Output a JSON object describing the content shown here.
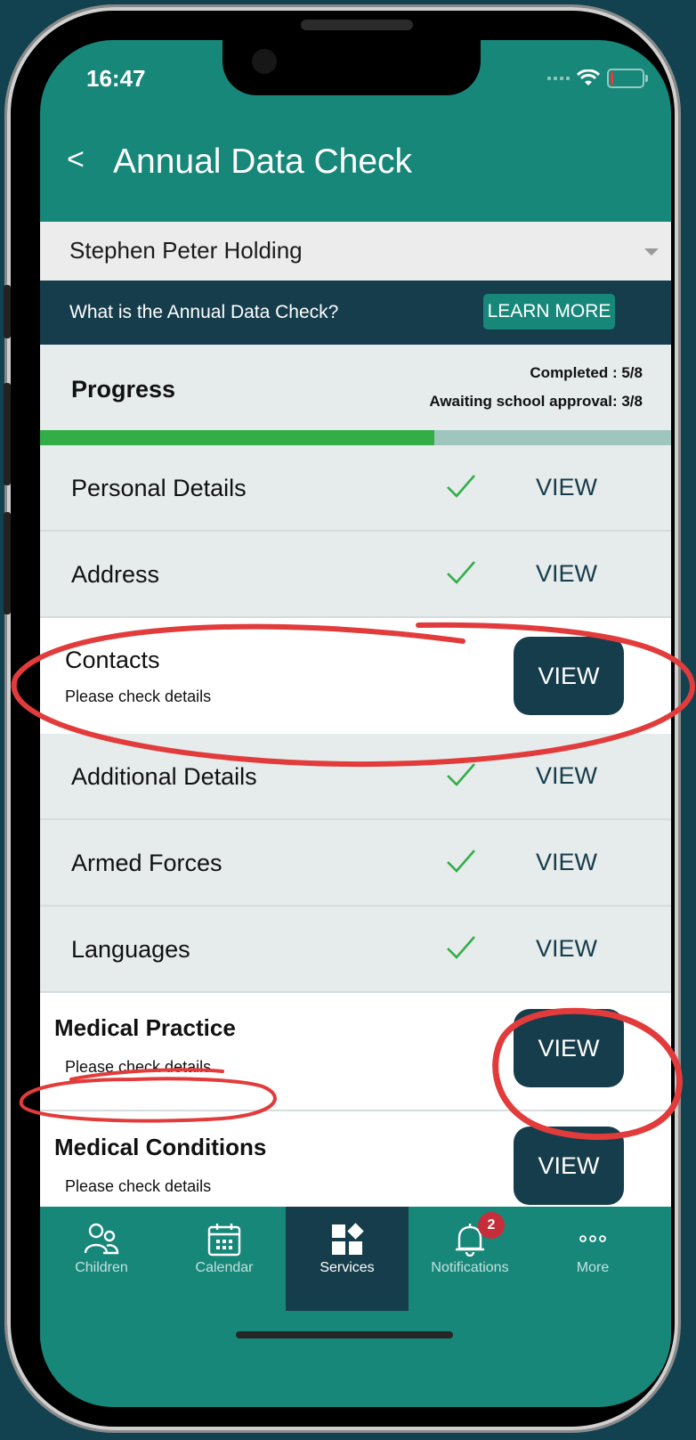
{
  "status_bar": {
    "time": "16:47"
  },
  "header": {
    "back_label": "<",
    "title": "Annual Data Check"
  },
  "child_picker": {
    "selected": "Stephen Peter Holding"
  },
  "info_banner": {
    "text": "What is the Annual Data Check?",
    "button_label": "LEARN MORE"
  },
  "progress": {
    "label": "Progress",
    "completed_text": "Completed : 5/8",
    "awaiting_text": "Awaiting school approval: 3/8",
    "completed_fraction": 0.625
  },
  "sections": [
    {
      "title": "Personal Details",
      "status": "done",
      "view_label": "VIEW"
    },
    {
      "title": "Address",
      "status": "done",
      "view_label": "VIEW"
    },
    {
      "title": "Contacts",
      "status": "todo",
      "subtitle": "Please check details",
      "view_label": "VIEW"
    },
    {
      "title": "Additional Details",
      "status": "done",
      "view_label": "VIEW"
    },
    {
      "title": "Armed Forces",
      "status": "done",
      "view_label": "VIEW"
    },
    {
      "title": "Languages",
      "status": "done",
      "view_label": "VIEW"
    },
    {
      "title": "Medical Practice",
      "status": "todo",
      "subtitle": "Please check details",
      "view_label": "VIEW"
    },
    {
      "title": "Medical Conditions",
      "status": "todo",
      "subtitle": "Please check details",
      "view_label": "VIEW"
    }
  ],
  "tab_bar": {
    "tabs": [
      {
        "label": "Children",
        "icon": "children-icon"
      },
      {
        "label": "Calendar",
        "icon": "calendar-icon"
      },
      {
        "label": "Services",
        "icon": "services-icon",
        "active": true
      },
      {
        "label": "Notifications",
        "icon": "bell-icon",
        "badge": "2"
      },
      {
        "label": "More",
        "icon": "more-icon"
      }
    ]
  },
  "colors": {
    "teal": "#17877a",
    "navy": "#163d4c",
    "progress_green": "#33ae47",
    "annotation_red": "#e23b3b"
  }
}
